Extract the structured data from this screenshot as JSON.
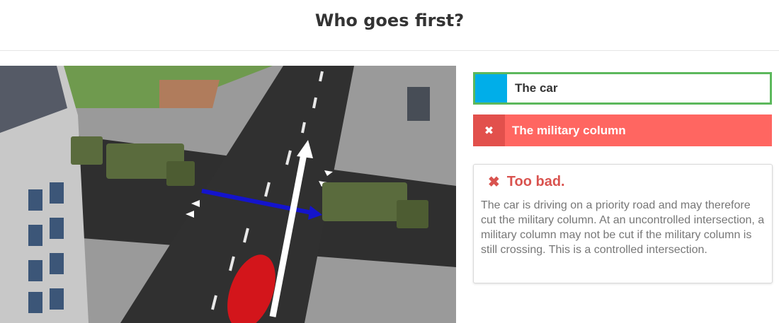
{
  "header": {
    "title": "Who goes first?"
  },
  "answers": [
    {
      "label": "The car",
      "state": "correct"
    },
    {
      "label": "The military column",
      "state": "wrong",
      "marker": "✖"
    }
  ],
  "feedback": {
    "icon": "✖",
    "title": "Too bad.",
    "text": "The car is driving on a priority road and may therefore cut the military column. At an uncontrolled intersection, a military column may not be cut if the military column is still crossing. This is a controlled intersection."
  },
  "colors": {
    "correct_border": "#5cb85c",
    "car_marker": "#00aee9",
    "wrong_background": "#ff6661",
    "wrong_marker": "#e2504c",
    "feedback_title": "#d9534f"
  }
}
